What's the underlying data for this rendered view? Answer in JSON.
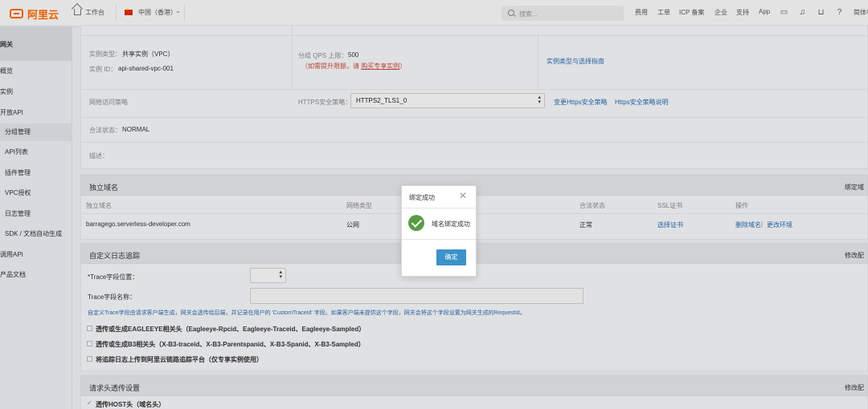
{
  "topbar": {
    "logo_text": "阿里云",
    "workbench": "工作台",
    "region": "中国（香港）",
    "search_placeholder": "搜索...",
    "links": [
      "费用",
      "工单",
      "ICP 备案",
      "企业",
      "支持",
      "App"
    ],
    "lang": "简体中"
  },
  "sidebar": {
    "header": "网关",
    "items": [
      {
        "label": "概览"
      },
      {
        "label": "实例"
      },
      {
        "label": "开放API"
      },
      {
        "label": "分组管理"
      },
      {
        "label": "API列表"
      },
      {
        "label": "插件管理"
      },
      {
        "label": "VPC授权"
      },
      {
        "label": "日志管理"
      },
      {
        "label": "SDK / 文档自动生成"
      },
      {
        "label": "调用API"
      },
      {
        "label": "产品文档"
      }
    ]
  },
  "instance": {
    "type_label": "实例类型：",
    "type_value": "共享实例（VPC）",
    "id_label": "实例 ID：",
    "id_value": "api-shared-vpc-001",
    "qps_label": "分组 QPS 上限：",
    "qps_value": "500",
    "qps_note_prefix": "（如需提升限额，请 ",
    "qps_note_link": "购买专享实例",
    "qps_note_suffix": "）",
    "guide_link": "实例类型与选择指南",
    "network_policy_label": "网络访问策略",
    "https_label": "HTTPS安全策略：",
    "https_value": "HTTPS2_TLS1_0",
    "change_https_link": "变更Https安全策略",
    "https_desc_link": "Https安全策略说明",
    "legal_label": "合法状态：",
    "legal_value": "NORMAL",
    "desc_label": "描述："
  },
  "domain_section": {
    "title": "独立域名",
    "side_action": "绑定域",
    "columns": [
      "独立域名",
      "网络类型",
      "合法状态",
      "SSL证书",
      "操作"
    ],
    "row": {
      "domain": "barragego.serverless-developer.com",
      "network": "公网",
      "status": "正常",
      "ssl": "选择证书",
      "action_delete": "删除域名",
      "action_sep": "|",
      "action_change": "更改环境"
    }
  },
  "log_section": {
    "title": "自定义日志追踪",
    "side_action": "修改配",
    "trace_position_label": "*Trace字段位置：",
    "trace_name_label": "Trace字段名称：",
    "info": "自定义Trace字段由请求客户端生成，网关会透传给后端，并记录在用户的 'CustomTraceId' 字段。如果客户端未提供这个字段，网关会将这个字段设置为网关生成的RequestId。",
    "options": [
      "透传或生成EAGLEEYE相关头（Eagleeye-Rpcid、Eagleeye-Traceid、Eagleeye-Sampled）",
      "透传或生成B3相关头（X-B3-traceid、X-B3-Parentspanid、X-B3-Spanid、X-B3-Sampled）",
      "将追踪日志上传到阿里云链路追踪平台（仅专享实例使用）"
    ]
  },
  "header_section": {
    "title": "请求头透传设置",
    "side_action": "修改配",
    "option": "透传HOST头（域名头）"
  },
  "modal": {
    "title": "绑定成功",
    "message": "域名绑定成功",
    "confirm": "确定",
    "close": "✕"
  }
}
